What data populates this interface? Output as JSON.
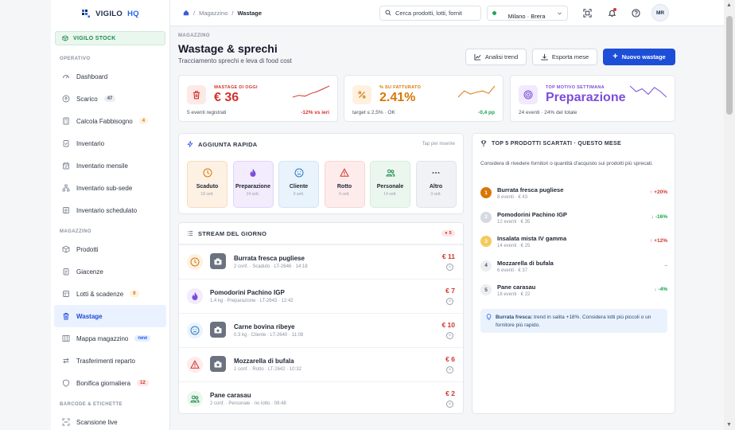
{
  "brand": {
    "name": "VIGILO",
    "suffix": "HQ"
  },
  "sidebar": {
    "stock_label": "VIGILO STOCK",
    "sections": [
      {
        "title": "OPERATIVO",
        "items": [
          {
            "label": "Dashboard",
            "icon": "gauge-icon"
          },
          {
            "label": "Scarico",
            "icon": "upload-icon",
            "badge": "47",
            "badge_style": "gray"
          },
          {
            "label": "Calcola Fabbisogno",
            "icon": "calculator-icon",
            "badge": "4",
            "badge_style": "orange"
          },
          {
            "label": "Inventario",
            "icon": "clipboard-icon"
          },
          {
            "label": "Inventario mensile",
            "icon": "calendar-icon"
          },
          {
            "label": "Inventario sub-sede",
            "icon": "sitemap-icon"
          },
          {
            "label": "Inventario schedulato",
            "icon": "schedule-icon"
          }
        ]
      },
      {
        "title": "MAGAZZINO",
        "items": [
          {
            "label": "Prodotti",
            "icon": "box-icon"
          },
          {
            "label": "Giacenze",
            "icon": "clipboard-list-icon"
          },
          {
            "label": "Lotti & scadenze",
            "icon": "layers-icon",
            "badge": "9",
            "badge_style": "orange"
          },
          {
            "label": "Wastage",
            "icon": "trash-icon",
            "active": true
          },
          {
            "label": "Mappa magazzino",
            "icon": "map-icon",
            "badge": "new",
            "badge_style": "blue"
          },
          {
            "label": "Trasferimenti reparto",
            "icon": "transfer-icon"
          },
          {
            "label": "Bonifica giornaliera",
            "icon": "shield-icon",
            "badge": "12",
            "badge_style": "red"
          }
        ]
      },
      {
        "title": "BARCODE & ETICHETTE",
        "items": [
          {
            "label": "Scansione live",
            "icon": "scan-icon"
          }
        ]
      }
    ]
  },
  "topbar": {
    "breadcrumb": [
      "Magazzino",
      "Wastage"
    ],
    "search_placeholder": "Cerca prodotti, lotti, fornit",
    "location": "Milano · Brera",
    "user_initials": "MR"
  },
  "page": {
    "kicker": "MAGAZZINO",
    "title": "Wastage & sprechi",
    "subtitle": "Tracciamento sprechi e leva di food cost",
    "buttons": {
      "trend": "Analisi trend",
      "export": "Esporta mese",
      "new": "Nuovo wastage"
    }
  },
  "kpis": [
    {
      "label": "WASTAGE DI OGGI",
      "value": "€ 36",
      "foot": "5 eventi registrati",
      "delta": "-12% vs ieri",
      "color": "#d1342b",
      "bg": "#fde9e7",
      "icon": "trash-icon",
      "delta_color": "#d1342b",
      "spark": [
        3,
        4,
        3.5,
        5,
        6,
        7.5,
        9
      ]
    },
    {
      "label": "% SU FATTURATO",
      "value": "2.41%",
      "foot": "target ≤ 2,5% · OK",
      "delta": "-0,4 pp",
      "color": "#d97706",
      "bg": "#fff1e0",
      "icon": "percent-icon",
      "delta_color": "#16a34a",
      "spark": [
        6,
        7,
        6.5,
        6.8,
        7,
        6.6,
        7.8
      ]
    },
    {
      "label": "TOP MOTIVO SETTIMANA",
      "value": "Preparazione",
      "foot": "24 eventi · 24% del totale",
      "delta": "",
      "color": "#7c4ddb",
      "bg": "#f1eafe",
      "icon": "target-icon",
      "delta_color": "#7c4ddb",
      "spark": [
        7,
        5,
        6,
        4,
        6.5,
        5,
        3
      ]
    }
  ],
  "quick_add": {
    "title": "AGGIUNTA RAPIDA",
    "hint": "Tap per inserire",
    "tiles": [
      {
        "label": "Scaduto",
        "sub": "18 sett.",
        "icon": "clock-icon",
        "bg": "#fdf1e4",
        "border": "#f6dcc0",
        "color": "#d97706"
      },
      {
        "label": "Preparazione",
        "sub": "24 sett.",
        "icon": "flame-icon",
        "bg": "#f2ecfd",
        "border": "#e1d4fa",
        "color": "#7c4ddb"
      },
      {
        "label": "Cliente",
        "sub": "9 sett.",
        "icon": "sad-face-icon",
        "bg": "#e9f3fc",
        "border": "#d3e6f8",
        "color": "#2b7bbf"
      },
      {
        "label": "Rotto",
        "sub": "6 sett.",
        "icon": "warning-icon",
        "bg": "#fdeceb",
        "border": "#f8d6d3",
        "color": "#d1342b"
      },
      {
        "label": "Personale",
        "sub": "14 sett.",
        "icon": "users-icon",
        "bg": "#ebf7ee",
        "border": "#d3eedb",
        "color": "#1f8a4c"
      },
      {
        "label": "Altro",
        "sub": "3 sett.",
        "icon": "dots-icon",
        "bg": "#f1f2f5",
        "border": "#e1e3e8",
        "color": "#4a5263"
      }
    ]
  },
  "stream": {
    "title": "STREAM DEL GIORNO",
    "badge": "● 5",
    "rows": [
      {
        "name": "Burrata fresca pugliese",
        "meta": "2 conf. · Scaduto · LT-2646 · 14:18",
        "amount": "€ 11",
        "icon": "clock-icon",
        "icon_bg": "#fdf1e4",
        "icon_color": "#d97706",
        "thumb": true
      },
      {
        "name": "Pomodorini Pachino IGP",
        "meta": "1.4 kg · Preparazione · LT-2643 · 12:42",
        "amount": "€ 7",
        "icon": "flame-icon",
        "icon_bg": "#f2ecfd",
        "icon_color": "#7c4ddb",
        "thumb": false
      },
      {
        "name": "Carne bovina ribeye",
        "meta": "0.3 kg · Cliente · LT-2640 · 11:08",
        "amount": "€ 10",
        "icon": "sad-face-icon",
        "icon_bg": "#e9f3fc",
        "icon_color": "#2b7bbf",
        "thumb": true
      },
      {
        "name": "Mozzarella di bufala",
        "meta": "1 conf. · Rotto · LT-2642 · 10:32",
        "amount": "€ 6",
        "icon": "warning-icon",
        "icon_bg": "#fdeceb",
        "icon_color": "#d1342b",
        "thumb": true
      },
      {
        "name": "Pane carasau",
        "meta": "2 conf. · Personale · no lotto · 09:48",
        "amount": "€ 2",
        "icon": "users-icon",
        "icon_bg": "#ebf7ee",
        "icon_color": "#1f8a4c",
        "thumb": false
      }
    ]
  },
  "top5": {
    "title": "TOP 5 PRODOTTI SCARTATI · QUESTO MESE",
    "intro": "Considera di rivedere fornitori o quantità d'acquisto sui prodotti più sprecati.",
    "items": [
      {
        "rank": "1",
        "name": "Burrata fresca pugliese",
        "meta": "8 eventi · € 43",
        "trend": "↑ +20%",
        "rank_bg": "#d97706",
        "rank_color": "#ffffff",
        "trend_color": "#d1342b"
      },
      {
        "rank": "2",
        "name": "Pomodorini Pachino IGP",
        "meta": "12 eventi · € 35",
        "trend": "↓ -16%",
        "rank_bg": "#d5d9e0",
        "rank_color": "#ffffff",
        "trend_color": "#16a34a"
      },
      {
        "rank": "3",
        "name": "Insalata mista IV gamma",
        "meta": "14 eventi · € 25",
        "trend": "↑ +12%",
        "rank_bg": "#f4c95d",
        "rank_color": "#ffffff",
        "trend_color": "#d1342b"
      },
      {
        "rank": "4",
        "name": "Mozzarella di bufala",
        "meta": "6 eventi · € 37",
        "trend": "–",
        "rank_bg": "#eceef2",
        "rank_color": "#4a5263",
        "trend_color": "#8a93a3"
      },
      {
        "rank": "5",
        "name": "Pane carasau",
        "meta": "18 eventi · € 22",
        "trend": "↓ -4%",
        "rank_bg": "#eceef2",
        "rank_color": "#4a5263",
        "trend_color": "#16a34a"
      }
    ],
    "tip_strong": "Burrata fresca:",
    "tip_text": " trend in salita +18%. Considera lotti più piccoli o un fornitore più rapido."
  }
}
